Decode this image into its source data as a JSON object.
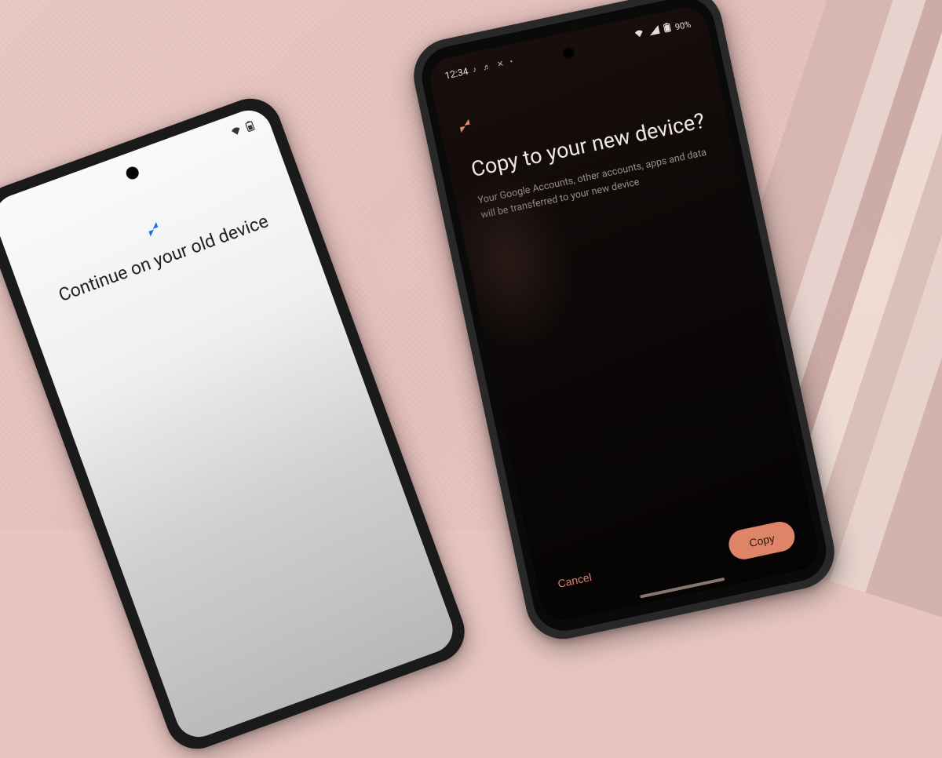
{
  "left_phone": {
    "title": "Continue on your old device",
    "status": {
      "wifi": "▾",
      "battery": "◧"
    }
  },
  "right_phone": {
    "status": {
      "time": "12:34",
      "app_icons": "♪ ♬ ✕ •",
      "signal": "▴",
      "wifi": "▾",
      "battery_pct": "90%"
    },
    "title": "Copy to your new device?",
    "subtitle": "Your Google Accounts, other accounts, apps and data will be transferred to your new device",
    "buttons": {
      "cancel": "Cancel",
      "copy": "Copy"
    }
  },
  "colors": {
    "accent_orange": "#de8468",
    "accent_blue": "#1a73e8"
  }
}
